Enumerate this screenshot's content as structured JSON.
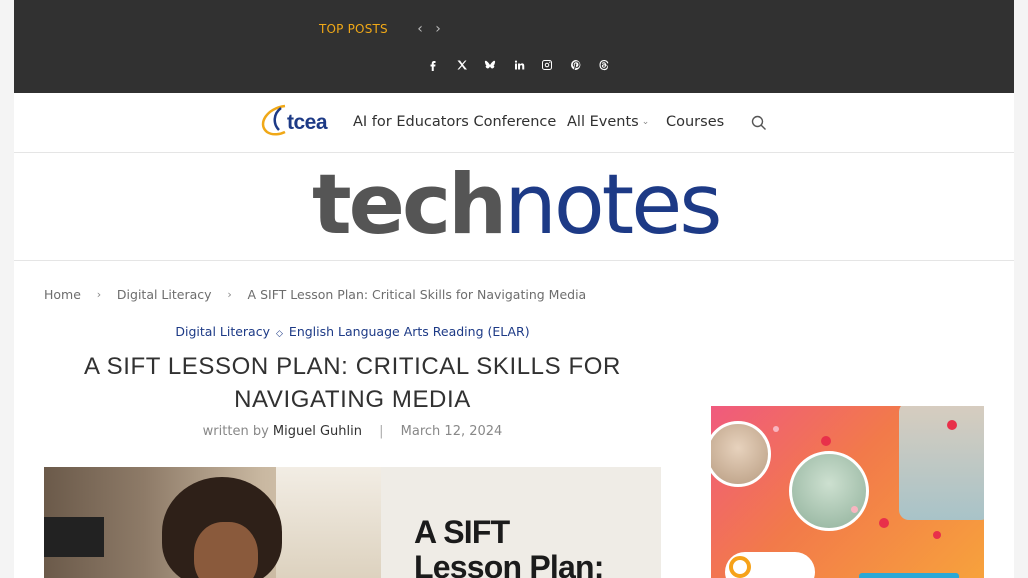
{
  "topbar": {
    "label": "TOP POSTS",
    "prev_icon": "chevron-left-icon",
    "next_icon": "chevron-right-icon",
    "socials": [
      "facebook-icon",
      "x-icon",
      "bluesky-icon",
      "linkedin-icon",
      "instagram-icon",
      "pinterest-icon",
      "threads-icon"
    ]
  },
  "nav": {
    "logo_text": "tcea",
    "items": [
      {
        "label": "AI for Educators Conference"
      },
      {
        "label": "All Events"
      },
      {
        "label": "Courses"
      }
    ],
    "search_icon": "search-icon"
  },
  "masthead": {
    "brand_part1": "tech",
    "brand_part2": "notes"
  },
  "breadcrumb": {
    "items": [
      "Home",
      "Digital Literacy"
    ],
    "current": "A SIFT Lesson Plan: Critical Skills for Navigating Media"
  },
  "article": {
    "categories": [
      "Digital Literacy",
      "English Language Arts Reading (ELAR)"
    ],
    "title": "A SIFT LESSON PLAN: CRITICAL SKILLS FOR NAVIGATING MEDIA",
    "written_by": "written by",
    "author": "Miguel Guhlin",
    "date": "March 12, 2024",
    "featured_text_line1": "A SIFT",
    "featured_text_line2": "Lesson Plan:"
  },
  "colors": {
    "topbar_bg": "#313131",
    "accent_orange": "#f0a817",
    "brand_blue": "#1d3a86"
  }
}
